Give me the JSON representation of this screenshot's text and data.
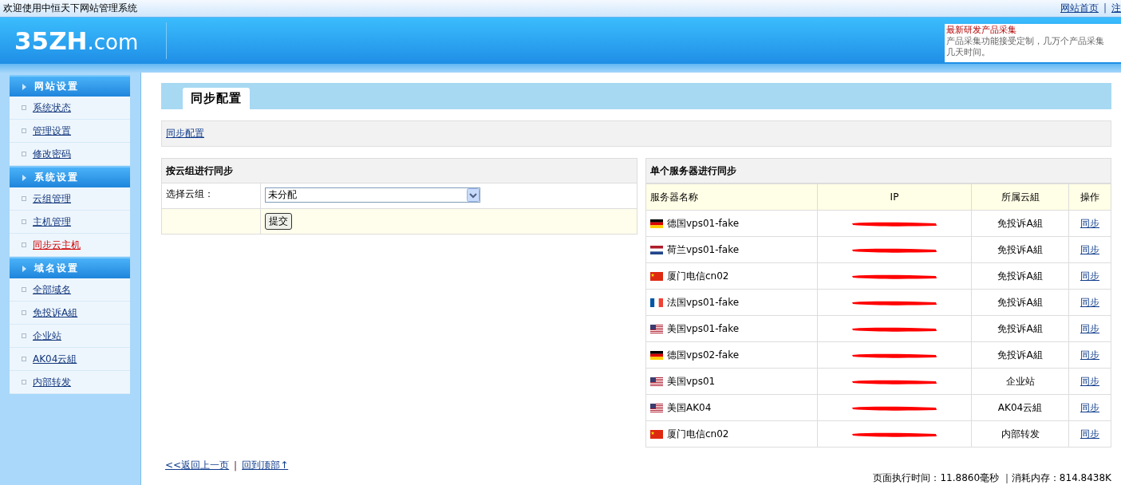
{
  "top_bar": {
    "welcome": "欢迎使用中恒天下网站管理系统",
    "links": [
      "网站首页",
      "注"
    ],
    "separator": "|"
  },
  "header": {
    "logo_main": "35ZH",
    "logo_suffix": ".com",
    "notice": {
      "title": "最新研发产品采集",
      "body": "产品采集功能接受定制，几万个产品采集",
      "body_line2": "几天时间。"
    }
  },
  "sidebar": {
    "groups": [
      {
        "title": "网站设置",
        "items": [
          {
            "label": "系统状态",
            "selected": false
          },
          {
            "label": "管理设置",
            "selected": false
          },
          {
            "label": "修改密码",
            "selected": false
          }
        ]
      },
      {
        "title": "系统设置",
        "items": [
          {
            "label": "云组管理",
            "selected": false
          },
          {
            "label": "主机管理",
            "selected": false
          },
          {
            "label": "同步云主机",
            "selected": true
          }
        ]
      },
      {
        "title": "域名设置",
        "items": [
          {
            "label": "全部域名",
            "selected": false
          },
          {
            "label": "免投诉A組",
            "selected": false
          },
          {
            "label": "企业站",
            "selected": false
          },
          {
            "label": "AK04云組",
            "selected": false
          },
          {
            "label": "内部转发",
            "selected": false
          }
        ]
      }
    ]
  },
  "page_tab": "同步配置",
  "breadcrumb": "同步配置",
  "group_sync": {
    "title": "按云组进行同步",
    "field_label": "选择云组：",
    "select_value": "未分配",
    "submit": "提交"
  },
  "server_sync": {
    "title": "单个服务器进行同步",
    "columns": [
      "服务器名称",
      "IP",
      "所属云組",
      "操作"
    ],
    "rows": [
      {
        "kind": "germany",
        "name": "德国vps01-fake",
        "group": "免投诉A組",
        "action": "同步"
      },
      {
        "kind": "netherlands",
        "name": "荷兰vps01-fake",
        "group": "免投诉A組",
        "action": "同步"
      },
      {
        "kind": "china",
        "name": "厦门电信cn02",
        "group": "免投诉A組",
        "action": "同步"
      },
      {
        "kind": "france",
        "name": "法国vps01-fake",
        "group": "免投诉A組",
        "action": "同步"
      },
      {
        "kind": "usa",
        "name": "美国vps01-fake",
        "group": "免投诉A組",
        "action": "同步"
      },
      {
        "kind": "germany",
        "name": "德国vps02-fake",
        "group": "免投诉A組",
        "action": "同步"
      },
      {
        "kind": "usa",
        "name": "美国vps01",
        "group": "企业站",
        "action": "同步"
      },
      {
        "kind": "usa",
        "name": "美国AK04",
        "group": "AK04云組",
        "action": "同步"
      },
      {
        "kind": "china",
        "name": "厦门电信cn02",
        "group": "内部转发",
        "action": "同步"
      }
    ]
  },
  "footer_links": {
    "back": "<<返回上一页",
    "separator": "|",
    "top": "回到顶部↑"
  },
  "stats": "页面执行时间：11.8860毫秒 ｜消耗内存：814.8438K"
}
